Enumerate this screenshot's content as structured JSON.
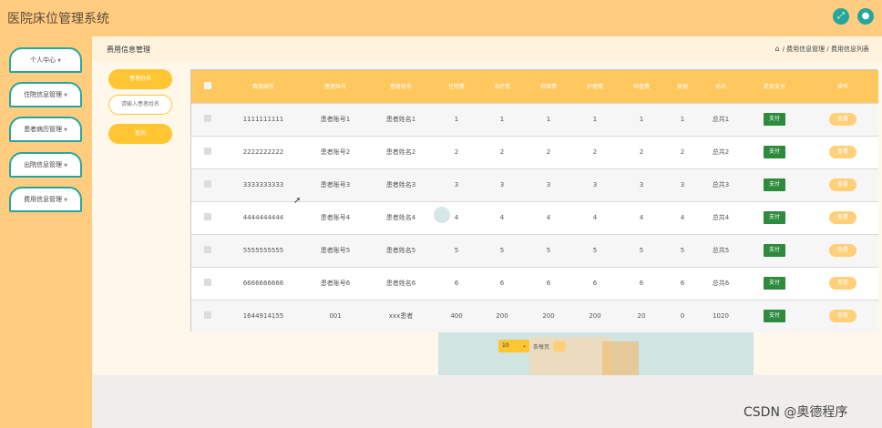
{
  "app": {
    "title": "医院床位管理系统"
  },
  "topbar": {
    "expand_icon": "⤢",
    "user_icon": "●"
  },
  "sidebar": {
    "items": [
      {
        "label": "个人中心",
        "caret": "▼"
      },
      {
        "label": "住院信息管理",
        "caret": "▼"
      },
      {
        "label": "患者病历管理",
        "caret": "▼"
      },
      {
        "label": "出院信息管理",
        "caret": "▼"
      },
      {
        "label": "费用信息管理",
        "caret": "▼"
      }
    ]
  },
  "breadcrumb": {
    "title": "费用信息管理",
    "home_icon": "⌂",
    "path": "/ 费用信息管理 / 费用信息列表"
  },
  "search": {
    "label": "患者姓名",
    "placeholder": "请输入患者姓名",
    "query_button": "查询"
  },
  "table": {
    "columns": [
      "费用编号",
      "患者账号",
      "患者姓名",
      "住院费",
      "治疗费",
      "检验费",
      "护理费",
      "检查费",
      "其他",
      "总共",
      "是否支付",
      "操作"
    ],
    "rows": [
      {
        "id": "1111111111",
        "account": "患者账号1",
        "name": "患者姓名1",
        "zhuyuan": "1",
        "zhiliao": "1",
        "jianyan": "1",
        "huli": "1",
        "jiancha": "1",
        "qita": "1",
        "total": "总共1",
        "pay": "支付",
        "op": "查看"
      },
      {
        "id": "2222222222",
        "account": "患者账号2",
        "name": "患者姓名2",
        "zhuyuan": "2",
        "zhiliao": "2",
        "jianyan": "2",
        "huli": "2",
        "jiancha": "2",
        "qita": "2",
        "total": "总共2",
        "pay": "支付",
        "op": "查看"
      },
      {
        "id": "3333333333",
        "account": "患者账号3",
        "name": "患者姓名3",
        "zhuyuan": "3",
        "zhiliao": "3",
        "jianyan": "3",
        "huli": "3",
        "jiancha": "3",
        "qita": "3",
        "total": "总共3",
        "pay": "支付",
        "op": "查看"
      },
      {
        "id": "4444444444",
        "account": "患者账号4",
        "name": "患者姓名4",
        "zhuyuan": "4",
        "zhiliao": "4",
        "jianyan": "4",
        "huli": "4",
        "jiancha": "4",
        "qita": "4",
        "total": "总共4",
        "pay": "支付",
        "op": "查看"
      },
      {
        "id": "5555555555",
        "account": "患者账号5",
        "name": "患者姓名5",
        "zhuyuan": "5",
        "zhiliao": "5",
        "jianyan": "5",
        "huli": "5",
        "jiancha": "5",
        "qita": "5",
        "total": "总共5",
        "pay": "支付",
        "op": "查看"
      },
      {
        "id": "6666666666",
        "account": "患者账号6",
        "name": "患者姓名6",
        "zhuyuan": "6",
        "zhiliao": "6",
        "jianyan": "6",
        "huli": "6",
        "jiancha": "6",
        "qita": "6",
        "total": "总共6",
        "pay": "支付",
        "op": "查看"
      },
      {
        "id": "1644914155",
        "account": "001",
        "name": "xxx患者",
        "zhuyuan": "400",
        "zhiliao": "200",
        "jianyan": "200",
        "huli": "200",
        "jiancha": "20",
        "qita": "0",
        "total": "1020",
        "pay": "支付",
        "op": "查看"
      }
    ]
  },
  "pagination": {
    "page_size": "10",
    "caret": "⌄",
    "text": "条每页"
  },
  "watermark": "CSDN @奥德程序",
  "colors": {
    "accent": "#ffc533",
    "teal": "#26a69a",
    "pay": "#2e8b3e"
  }
}
